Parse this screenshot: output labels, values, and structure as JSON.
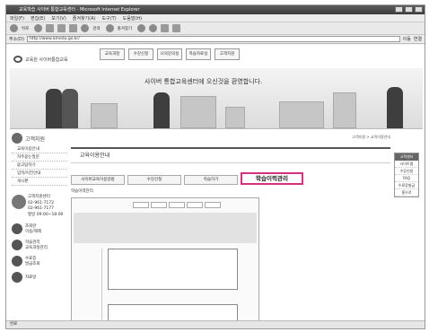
{
  "browser": {
    "title": "교육학습 사이버 통합교육센터 - Microsoft Internet Explorer",
    "menu": [
      "파일(F)",
      "편집(E)",
      "보기(V)",
      "즐겨찾기(A)",
      "도구(T)",
      "도움말(H)"
    ],
    "toolbar": {
      "back_label": "뒤로",
      "search_label": "검색",
      "favorites_label": "즐겨찾기"
    },
    "address_label": "주소(D)",
    "address": "http://www.amedu.go.kr/",
    "go_label": "이동",
    "links_label": "연결",
    "status": "완료"
  },
  "site": {
    "logo": "교육원 사이버통합교육",
    "top_nav": [
      "교육과정",
      "수강신청",
      "나의강의실",
      "학습자료실",
      "고객지원"
    ],
    "slogan": "사이버 통합교육센터에 오신것을 환영합니다."
  },
  "sidebar": {
    "title": "고객지원",
    "menu": [
      "교육이용안내",
      "자주묻는질문",
      "묻고답하기",
      "입학/이전안내",
      "게시판"
    ],
    "contact": {
      "title": "고객지원센터",
      "lines": [
        "02-961-7172",
        "02-961-7177",
        "평일 09:00~18:00"
      ]
    },
    "quick_links": [
      {
        "label": "조회란",
        "sub": "이용/해제"
      },
      {
        "label": "학습관리",
        "sub": "교육과정관리"
      },
      {
        "label": "수료증",
        "sub": "발급조회"
      },
      {
        "label": "자료방"
      }
    ]
  },
  "main": {
    "breadcrumb": "고객지원 > 교육이용안내",
    "page_title": "교육이용안내",
    "tabs": [
      "사이버교육이용방법",
      "수강신청",
      "학습하기",
      "학습이력관리"
    ],
    "active_tab": "학습이력관리",
    "sub_label": "학습이력관리"
  },
  "right_panel": {
    "head": "고객센터",
    "items": [
      "사이트맵",
      "수강신청",
      "FAQ",
      "수료증발급",
      "홈으로"
    ]
  }
}
